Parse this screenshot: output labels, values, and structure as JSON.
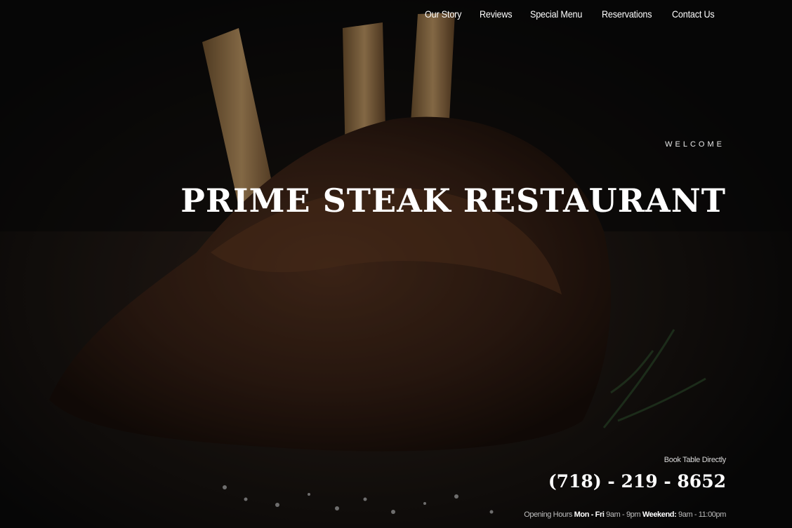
{
  "nav": {
    "items": [
      {
        "label": "Our Story"
      },
      {
        "label": "Reviews"
      },
      {
        "label": "Special Menu"
      },
      {
        "label": "Reservations"
      },
      {
        "label": "Contact Us"
      }
    ]
  },
  "hero": {
    "eyebrow": "WELCOME",
    "title": "PRIME STEAK RESTAURANT",
    "book_label": "Book Table Directly",
    "phone": "(718) - 219 - 8652",
    "hours": {
      "label": "Opening Hours",
      "weekday_label": "Mon - Fri",
      "weekday_time": "9am - 9pm",
      "weekend_label": "Weekend:",
      "weekend_time": "9am - 11:00pm"
    }
  },
  "colors": {
    "background": "#0b0b0b",
    "text": "#ffffff",
    "muted": "#bdbdbd"
  }
}
